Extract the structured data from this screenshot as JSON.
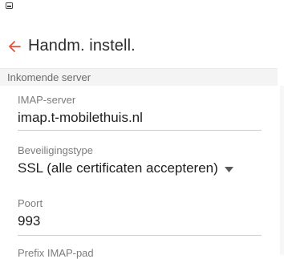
{
  "app_bar": {
    "title": "Handm. instell."
  },
  "section": {
    "header": "Inkomende server"
  },
  "fields": {
    "server": {
      "label": "IMAP-server",
      "value": "imap.t-mobilethuis.nl"
    },
    "security": {
      "label": "Beveiligingstype",
      "value": "SSL (alle certificaten accepteren)"
    },
    "port": {
      "label": "Poort",
      "value": "993"
    },
    "prefix": {
      "label": "Prefix IMAP-pad"
    }
  },
  "icons": {
    "status": "image-notification-icon",
    "back": "arrow-left-icon",
    "dropdown": "triangle-down-icon"
  },
  "colors": {
    "accent": "#e8503a"
  }
}
